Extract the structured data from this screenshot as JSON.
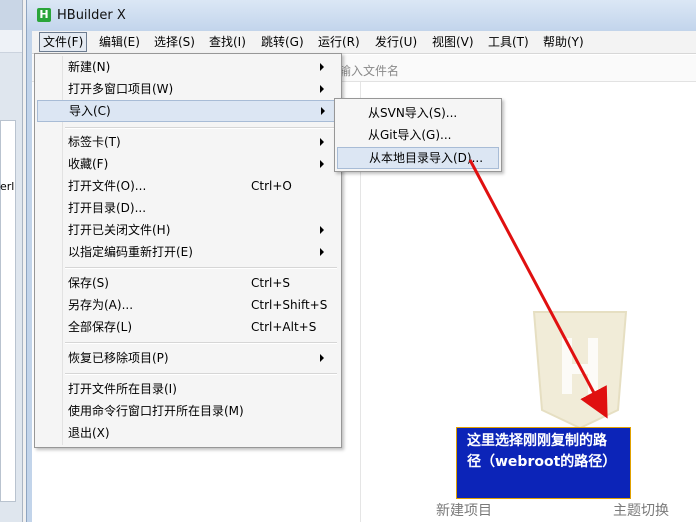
{
  "left_window": {
    "fragment_text": "erl"
  },
  "window": {
    "title": "HBuilder X",
    "logo_letter": "H"
  },
  "menubar": [
    {
      "label": "文件(F)"
    },
    {
      "label": "编辑(E)"
    },
    {
      "label": "选择(S)"
    },
    {
      "label": "查找(I)"
    },
    {
      "label": "跳转(G)"
    },
    {
      "label": "运行(R)"
    },
    {
      "label": "发行(U)"
    },
    {
      "label": "视图(V)"
    },
    {
      "label": "工具(T)"
    },
    {
      "label": "帮助(Y)"
    }
  ],
  "search": {
    "placeholder": "输入文件名"
  },
  "file_menu": [
    {
      "label": "新建(N)",
      "shortcut": "",
      "submenu": true
    },
    {
      "label": "打开多窗口项目(W)",
      "shortcut": "",
      "submenu": true
    },
    {
      "label": "导入(C)",
      "shortcut": "",
      "submenu": true,
      "highlighted": true
    },
    {
      "label": "标签卡(T)",
      "shortcut": "",
      "submenu": true
    },
    {
      "label": "收藏(F)",
      "shortcut": "",
      "submenu": true
    },
    {
      "label": "打开文件(O)...",
      "shortcut": "Ctrl+O",
      "submenu": false
    },
    {
      "label": "打开目录(D)...",
      "shortcut": "",
      "submenu": false
    },
    {
      "label": "打开已关闭文件(H)",
      "shortcut": "",
      "submenu": true
    },
    {
      "label": "以指定编码重新打开(E)",
      "shortcut": "",
      "submenu": true
    },
    {
      "label": "保存(S)",
      "shortcut": "Ctrl+S",
      "submenu": false
    },
    {
      "label": "另存为(A)...",
      "shortcut": "Ctrl+Shift+S",
      "submenu": false
    },
    {
      "label": "全部保存(L)",
      "shortcut": "Ctrl+Alt+S",
      "submenu": false
    },
    {
      "label": "恢复已移除项目(P)",
      "shortcut": "",
      "submenu": true
    },
    {
      "label": "打开文件所在目录(I)",
      "shortcut": "",
      "submenu": false
    },
    {
      "label": "使用命令行窗口打开所在目录(M)",
      "shortcut": "",
      "submenu": false
    },
    {
      "label": "退出(X)",
      "shortcut": "",
      "submenu": false
    }
  ],
  "import_submenu": [
    {
      "label": "从SVN导入(S)..."
    },
    {
      "label": "从Git导入(G)..."
    },
    {
      "label": "从本地目录导入(D)...",
      "highlighted": true
    }
  ],
  "welcome": {
    "new_project": "新建项目",
    "theme_switch": "主题切换"
  },
  "annotation": {
    "text": "这里选择刚刚复制的路径（webroot的路径）",
    "bg_color": "#0c24b8",
    "arrow_color": "#e01010"
  },
  "colors": {
    "highlight": "#dce6f3",
    "logo_green": "#2aa53a"
  }
}
